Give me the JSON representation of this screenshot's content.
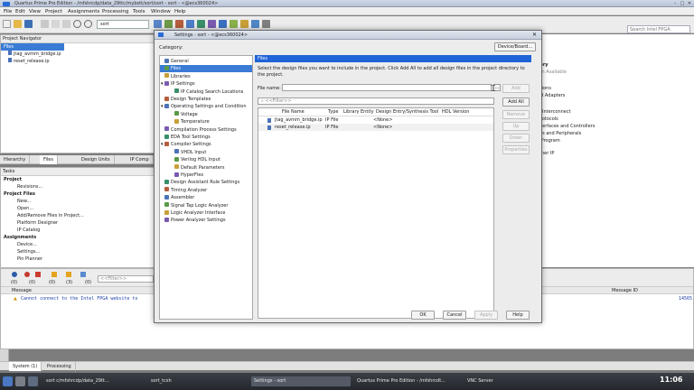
{
  "main_window": {
    "title": "Quartus Prime Pro Edition - /mfshrcdp/data_29ttc/mybstt/sort/sort - sort - <@ecs360024>",
    "menu": [
      "File",
      "Edit",
      "View",
      "Project",
      "Assignments",
      "Processing",
      "Tools",
      "Window",
      "Help"
    ],
    "toolbar_combo_value": "sort",
    "search_placeholder": "Search Intel FPGA"
  },
  "project_navigator": {
    "title": "Project Navigator",
    "selected_header": "Files",
    "files": [
      "jtag_avmm_bridge.ip",
      "reset_release.ip"
    ],
    "tabs": [
      "Hierarchy",
      "Files",
      "Design Units",
      "IP Comp"
    ]
  },
  "tasks": {
    "title": "Tasks",
    "items": [
      "Project",
      "Revisions...",
      "Project Files",
      "New...",
      "Open...",
      "Add/Remove Files in Project...",
      "Platform Designer",
      "IP Catalog",
      "Assignments",
      "Device...",
      "Settings...",
      "Pin Planner"
    ]
  },
  "messages": {
    "counts": [
      "(0)",
      "(0)",
      "(0)",
      "(3)",
      "(0)"
    ],
    "filter_placeholder": "<<Filter>>",
    "col_message": "Message",
    "col_message_id": "Message ID",
    "line": "Cannot connect to the Intel FPGA website to",
    "line_id": "14565"
  },
  "bottom_tabs": [
    "System (1)",
    "Processing"
  ],
  "ip_catalog_peek": [
    "tory",
    "ion Available",
    "ctions",
    "nd Adapters",
    "A Interconnect",
    "Protocols",
    "nterfaces and Controllers",
    "ars and Peripherals",
    "r Program",
    "rtner IP"
  ],
  "dialog": {
    "title": "Settings - sort - <@ecs360024>",
    "category_label": "Category:",
    "device_board_button": "Device/Board...",
    "categories": [
      {
        "label": "General",
        "indent": 0,
        "icon": "general-icon"
      },
      {
        "label": "Files",
        "indent": 0,
        "icon": "files-icon",
        "selected": true
      },
      {
        "label": "Libraries",
        "indent": 0,
        "icon": "libraries-icon"
      },
      {
        "label": "IP Settings",
        "indent": 0,
        "icon": "ip-settings-icon",
        "expand": "▾"
      },
      {
        "label": "IP Catalog Search Locations",
        "indent": 1,
        "icon": "ip-catalog-icon"
      },
      {
        "label": "Design Templates",
        "indent": 0,
        "icon": "design-templates-icon"
      },
      {
        "label": "Operating Settings and Condition",
        "indent": 0,
        "icon": "operating-settings-icon",
        "expand": "▾"
      },
      {
        "label": "Voltage",
        "indent": 1,
        "icon": "voltage-icon"
      },
      {
        "label": "Temperature",
        "indent": 1,
        "icon": "temperature-icon"
      },
      {
        "label": "Compilation Process Settings",
        "indent": 0,
        "icon": "compilation-icon"
      },
      {
        "label": "EDA Tool Settings",
        "indent": 0,
        "icon": "eda-icon"
      },
      {
        "label": "Compiler Settings",
        "indent": 0,
        "icon": "compiler-icon",
        "expand": "▾"
      },
      {
        "label": "VHDL Input",
        "indent": 1,
        "icon": "vhdl-icon"
      },
      {
        "label": "Verilog HDL Input",
        "indent": 1,
        "icon": "verilog-icon"
      },
      {
        "label": "Default Parameters",
        "indent": 1,
        "icon": "parameters-icon"
      },
      {
        "label": "HyperFlex",
        "indent": 1,
        "icon": "hyperflex-icon"
      },
      {
        "label": "Design Assistant Rule Settings",
        "indent": 0,
        "icon": "design-assistant-icon"
      },
      {
        "label": "Timing Analyzer",
        "indent": 0,
        "icon": "timing-icon"
      },
      {
        "label": "Assembler",
        "indent": 0,
        "icon": "assembler-icon"
      },
      {
        "label": "Signal Tap Logic Analyzer",
        "indent": 0,
        "icon": "signaltap-icon"
      },
      {
        "label": "Logic Analyzer Interface",
        "indent": 0,
        "icon": "lai-icon"
      },
      {
        "label": "Power Analyzer Settings",
        "indent": 0,
        "icon": "power-icon"
      }
    ],
    "files_page": {
      "header": "Files",
      "description": "Select the design files you want to include in the project. Click Add All to add all design files in the project directory to the project.",
      "file_name_label": "File name:",
      "file_name_value": "",
      "filter_placeholder": "<<Filter>>",
      "columns": [
        "File Name",
        "Type",
        "Library",
        "Entity",
        "Design Entry/Synthesis Tool",
        "HDL Version"
      ],
      "rows": [
        {
          "file": "jtag_avmm_bridge.ip",
          "type": "IP File",
          "tool": "<None>"
        },
        {
          "file": "reset_release.ip",
          "type": "IP File",
          "tool": "<None>"
        }
      ],
      "buttons": {
        "add": "Add",
        "add_all": "Add All",
        "remove": "Remove",
        "up": "Up",
        "down": "Down",
        "properties": "Properties"
      }
    },
    "footer_buttons": {
      "ok": "OK",
      "cancel": "Cancel",
      "apply": "Apply",
      "help": "Help"
    }
  },
  "taskbar": {
    "tasks": [
      "sort c/mfshrcdp/data_29tt...",
      "sort_tcsh",
      "Settings - sort",
      "Quartus Prime Pro Edition - /mfshrcdt...",
      "VNC Server"
    ],
    "clock": "11:06"
  },
  "colors": {
    "selection": "#1f63d8",
    "taskbar": "#2d3035",
    "message_text": "#1c3ea8"
  }
}
